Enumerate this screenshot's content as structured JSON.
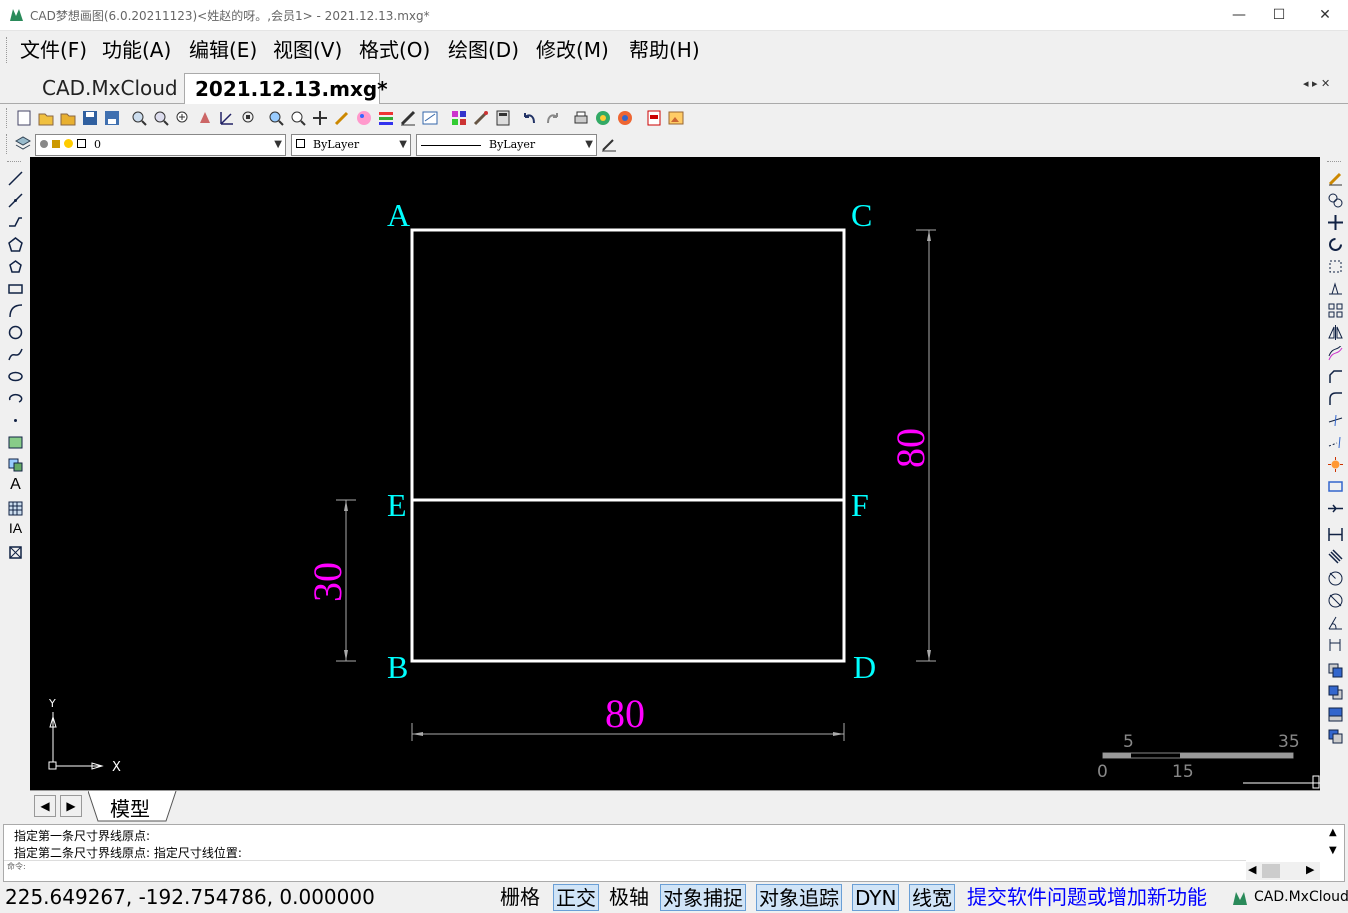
{
  "window": {
    "title": "CAD梦想画图(6.0.20211123)<姓赵的呀。,会员1> - 2021.12.13.mxg*",
    "minimize": "—",
    "maximize": "☐",
    "close": "✕"
  },
  "menu": [
    "文件(F)",
    "功能(A)",
    "编辑(E)",
    "视图(V)",
    "格式(O)",
    "绘图(D)",
    "修改(M)",
    "帮助(H)"
  ],
  "tabs": {
    "inactive": "CAD.MxCloud",
    "active": "2021.12.13.mxg*",
    "nav": "◂ ▸ ✕"
  },
  "properties": {
    "layer": "0",
    "color": "ByLayer",
    "linetype": "ByLayer"
  },
  "drawing": {
    "labels": {
      "A": "A",
      "B": "B",
      "C": "C",
      "D": "D",
      "E": "E",
      "F": "F"
    },
    "dimensions": {
      "width": "80",
      "height": "80",
      "lower": "30"
    },
    "ucs": {
      "x": "X",
      "y": "Y"
    },
    "scale": {
      "t1": "5",
      "t2": "35",
      "b1": "0",
      "b2": "15"
    }
  },
  "layout": {
    "tab": "模型"
  },
  "command": {
    "line1": "指定第一条尺寸界线原点:",
    "line2": "指定第二条尺寸界线原点:  指定尺寸线位置:",
    "prompt": "命令:"
  },
  "status": {
    "coords": "225.649267,  -192.754786,  0.000000",
    "grid": "栅格",
    "ortho": "正交",
    "polar": "极轴",
    "osnap": "对象捕捉",
    "otrack": "对象追踪",
    "dyn": "DYN",
    "lwt": "线宽",
    "feedback": "提交软件问题或增加新功能",
    "brand": "CAD.MxCloud"
  },
  "colors": {
    "cyan": "#00ffff",
    "magenta": "#ff00ff",
    "link": "#0000ff"
  }
}
